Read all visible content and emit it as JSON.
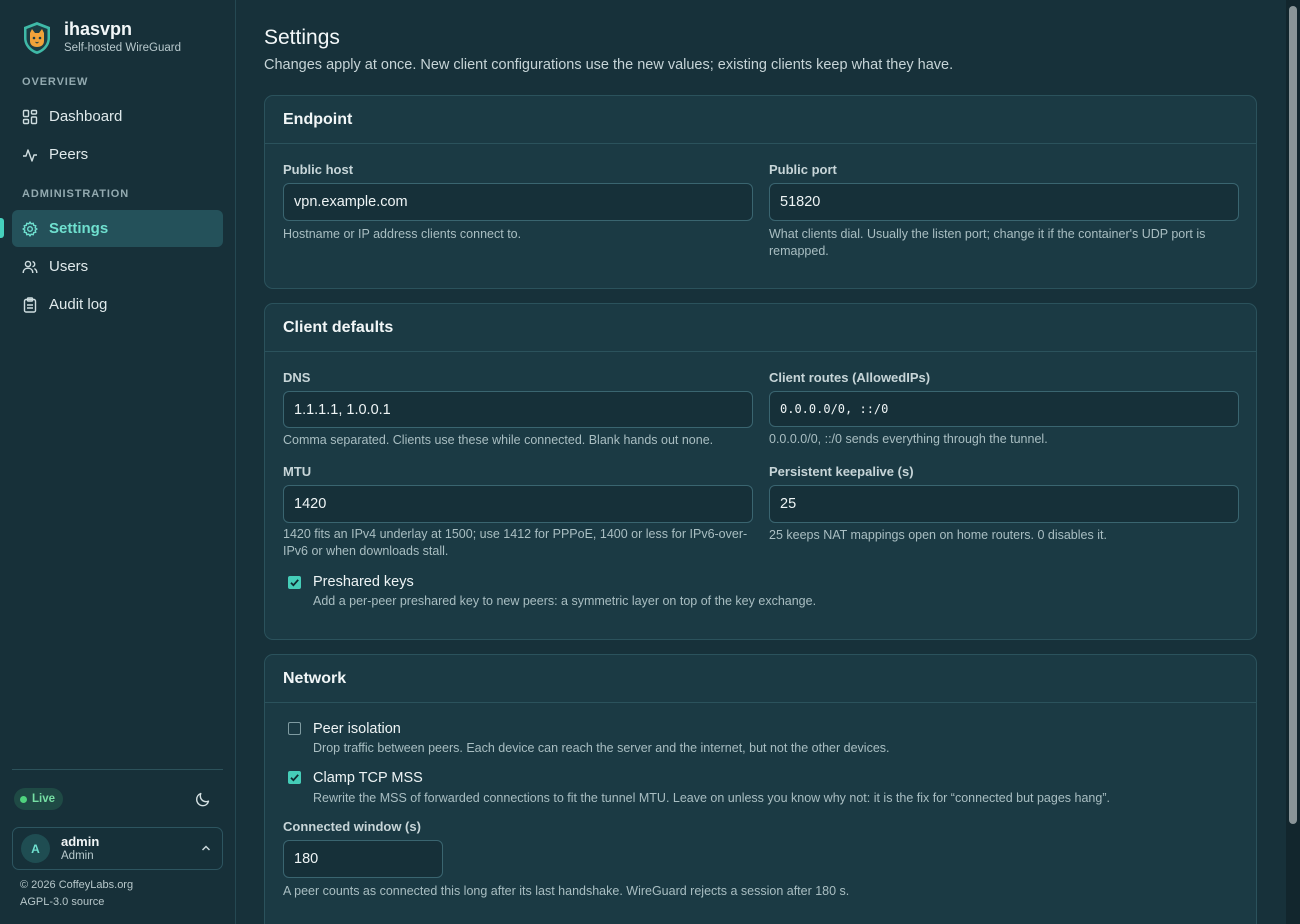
{
  "brand": {
    "name": "ihasvpn",
    "subtitle": "Self-hosted WireGuard",
    "logo_icon": "cat-shield-icon"
  },
  "sidebar": {
    "sections": [
      "OVERVIEW",
      "ADMINISTRATION"
    ],
    "items": [
      {
        "label": "Dashboard",
        "icon": "dashboard-grid-icon"
      },
      {
        "label": "Peers",
        "icon": "activity-pulse-icon"
      },
      {
        "label": "Settings",
        "icon": "gear-icon",
        "active": true
      },
      {
        "label": "Users",
        "icon": "users-icon"
      },
      {
        "label": "Audit log",
        "icon": "clipboard-icon"
      }
    ],
    "status": "Live",
    "user": {
      "initial": "A",
      "name": "admin",
      "role": "Admin"
    },
    "footer": {
      "copyright": "© 2026 CoffeyLabs.org",
      "license": "AGPL-3.0 source"
    }
  },
  "page": {
    "title": "Settings",
    "subtitle": "Changes apply at once. New client configurations use the new values; existing clients keep what they have."
  },
  "endpoint": {
    "title": "Endpoint",
    "host_label": "Public host",
    "host_value": "vpn.example.com",
    "host_hint": "Hostname or IP address clients connect to.",
    "port_label": "Public port",
    "port_value": "51820",
    "port_hint": "What clients dial. Usually the listen port; change it if the container's UDP port is remapped."
  },
  "client_defaults": {
    "title": "Client defaults",
    "dns_label": "DNS",
    "dns_value": "1.1.1.1, 1.0.0.1",
    "dns_hint": "Comma separated. Clients use these while connected. Blank hands out none.",
    "routes_label": "Client routes (AllowedIPs)",
    "routes_value": "0.0.0.0/0, ::/0",
    "routes_hint": "0.0.0.0/0, ::/0 sends everything through the tunnel.",
    "mtu_label": "MTU",
    "mtu_value": "1420",
    "mtu_hint": "1420 fits an IPv4 underlay at 1500; use 1412 for PPPoE, 1400 or less for IPv6-over-IPv6 or when downloads stall.",
    "keepalive_label": "Persistent keepalive (s)",
    "keepalive_value": "25",
    "keepalive_hint": "25 keeps NAT mappings open on home routers. 0 disables it.",
    "psk_label": "Preshared keys",
    "psk_checked": true,
    "psk_hint": "Add a per-peer preshared key to new peers: a symmetric layer on top of the key exchange."
  },
  "network": {
    "title": "Network",
    "isolation_label": "Peer isolation",
    "isolation_checked": false,
    "isolation_hint": "Drop traffic between peers. Each device can reach the server and the internet, but not the other devices.",
    "mss_label": "Clamp TCP MSS",
    "mss_checked": true,
    "mss_hint": "Rewrite the MSS of forwarded connections to fit the tunnel MTU. Leave on unless you know why not: it is the fix for “connected but pages hang”.",
    "window_label": "Connected window (s)",
    "window_value": "180",
    "window_hint": "A peer counts as connected this long after its last handshake. WireGuard rejects a session after 180 s."
  },
  "colors": {
    "accent": "#45cdb8",
    "background": "#17313a",
    "card": "#1b3a44",
    "live": "#4fd37e"
  }
}
